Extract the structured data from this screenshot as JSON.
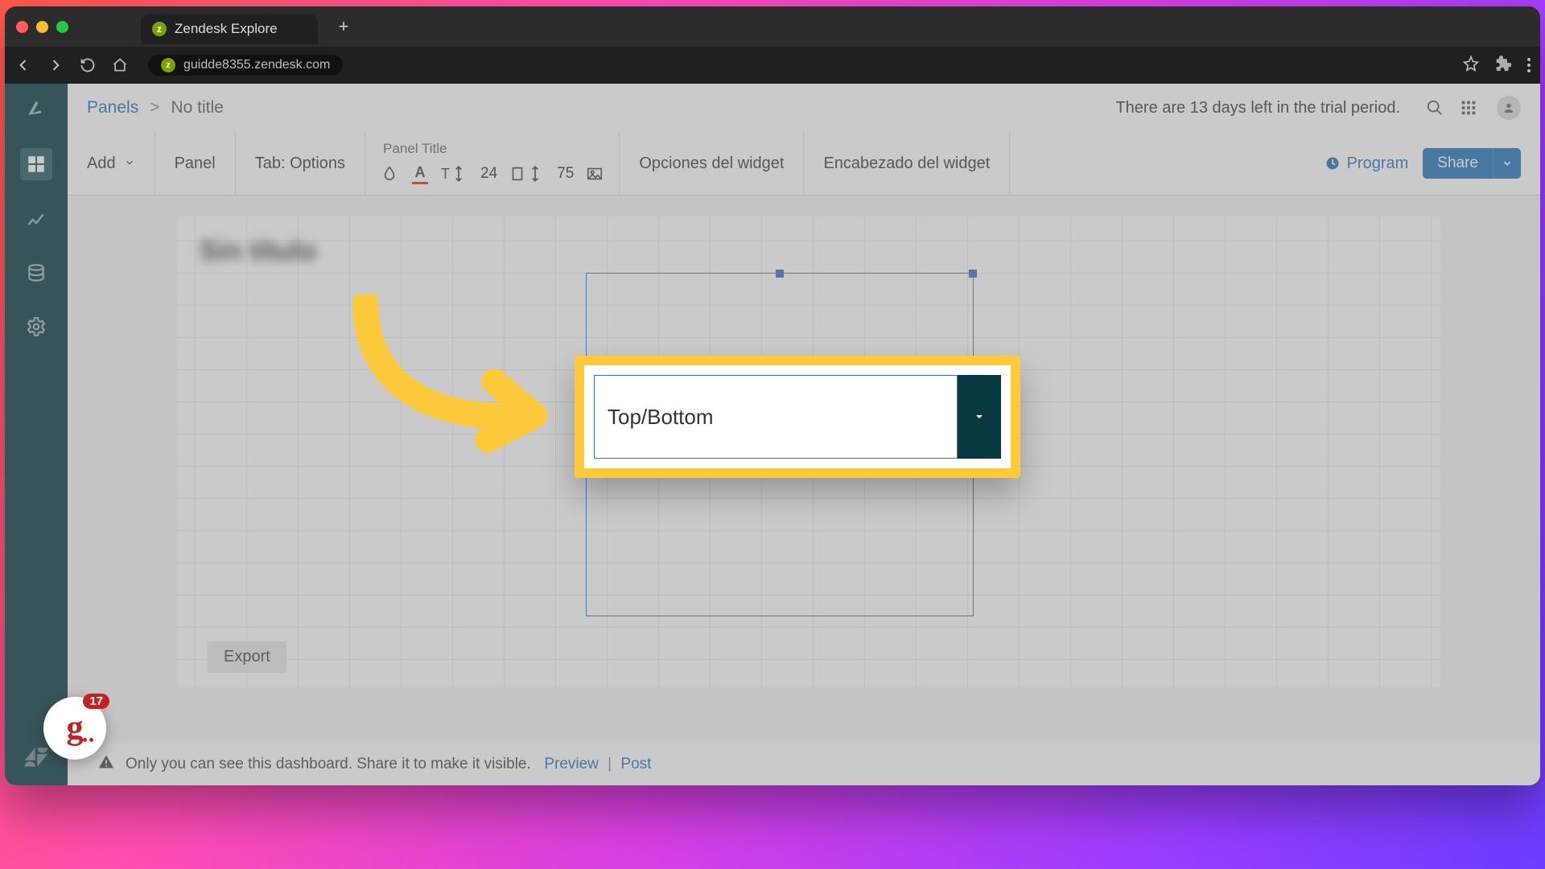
{
  "browser": {
    "tab_title": "Zendesk Explore",
    "url": "guidde8355.zendesk.com"
  },
  "breadcrumb": {
    "root": "Panels",
    "sep": ">",
    "current": "No title"
  },
  "trial_notice": "There are 13 days left in the trial period.",
  "toolbar": {
    "add": "Add",
    "panel": "Panel",
    "tab_options": "Tab: Options",
    "panel_title_label": "Panel Title",
    "font_size": "24",
    "width_value": "75",
    "widget_options": "Opciones del widget",
    "widget_header": "Encabezado del widget",
    "program": "Program",
    "share": "Share"
  },
  "canvas": {
    "blurred_title": "Sin título",
    "export": "Export"
  },
  "callout": {
    "label": "Top/Bottom"
  },
  "footer": {
    "message": "Only you can see this dashboard. Share it to make it visible.",
    "preview": "Preview",
    "post": "Post"
  },
  "guidde": {
    "badge": "17"
  }
}
